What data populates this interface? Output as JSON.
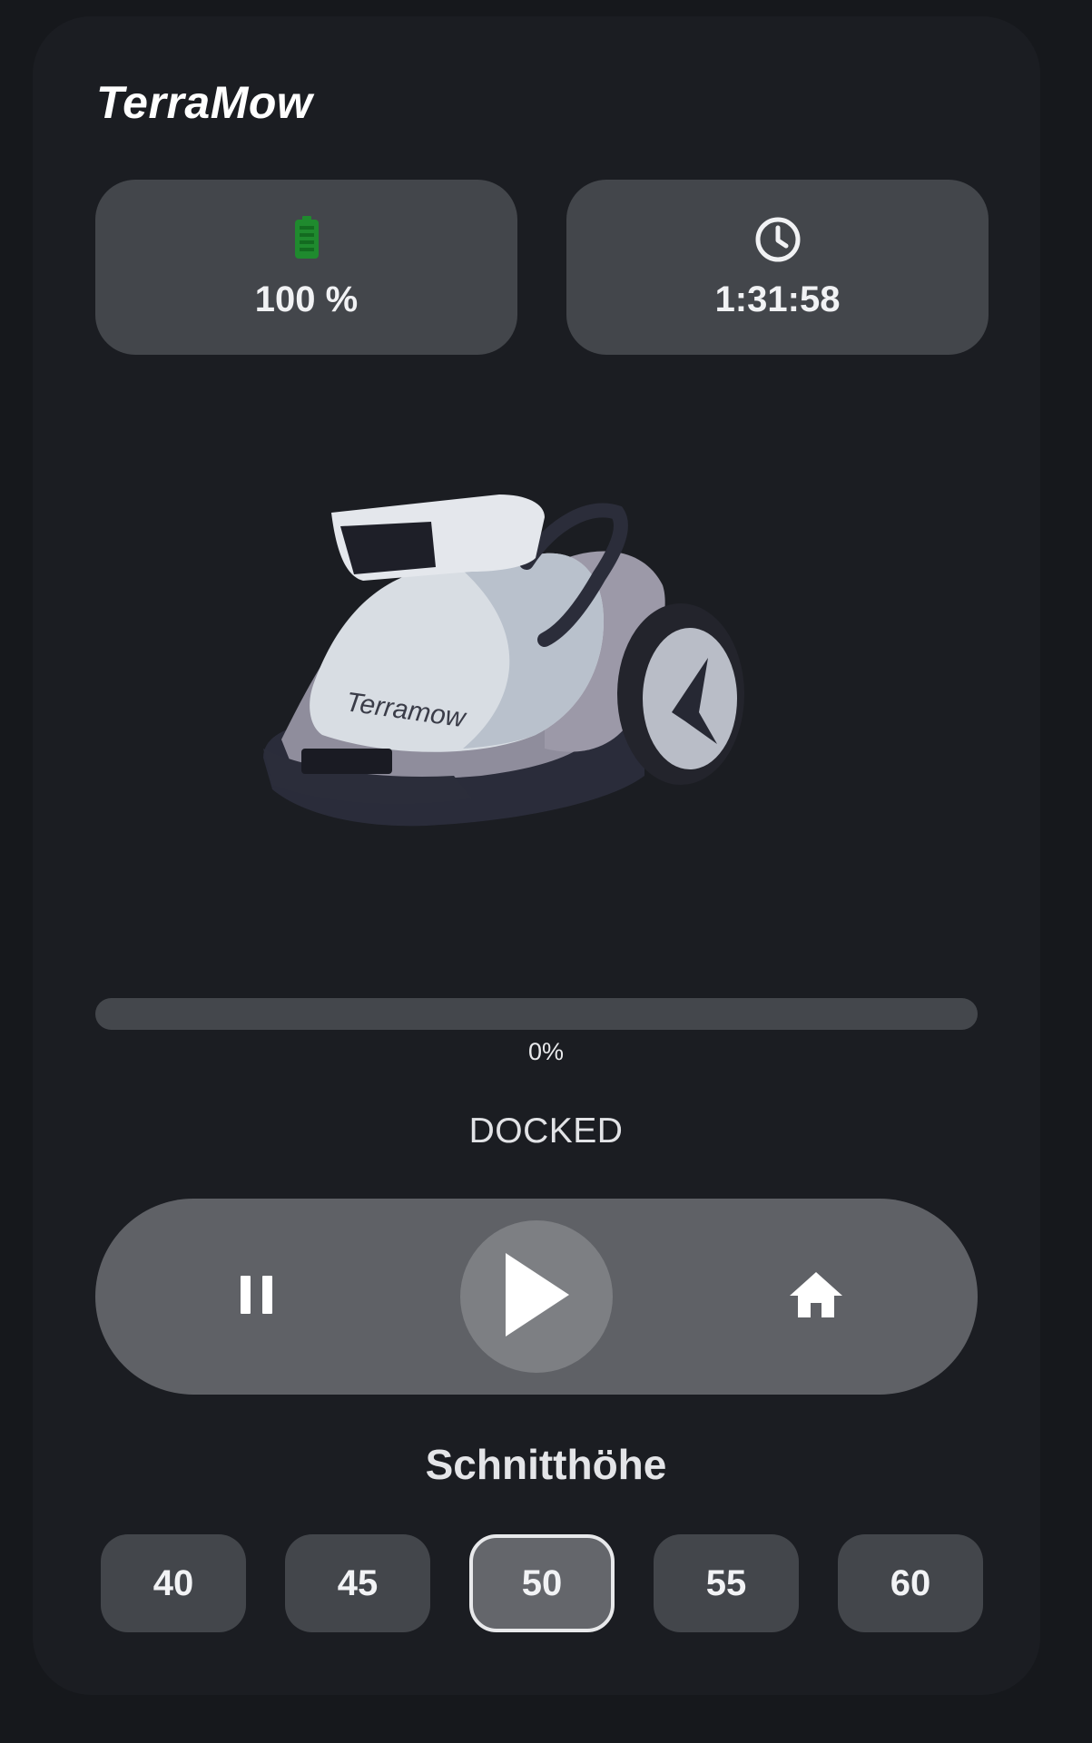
{
  "app": {
    "title": "TerraMow"
  },
  "stats": {
    "battery": {
      "value": "100 %",
      "icon": "battery-full-icon",
      "color": "#1f8a2e"
    },
    "runtime": {
      "value": "1:31:58",
      "icon": "clock-icon"
    }
  },
  "mower_image": {
    "brand_text": "Terramow"
  },
  "progress": {
    "percent": 0,
    "label": "0%"
  },
  "status": {
    "text": "DOCKED"
  },
  "controls": {
    "pause_icon": "pause-icon",
    "play_icon": "play-icon",
    "home_icon": "home-icon"
  },
  "cutting_height": {
    "title": "Schnitthöhe",
    "options": [
      "40",
      "45",
      "50",
      "55",
      "60"
    ],
    "selected": "50"
  },
  "colors": {
    "background": "#16181c",
    "card": "#1b1d22",
    "tile": "#43464b",
    "control_bar": "#5f6166",
    "accent_battery": "#1f8a2e"
  }
}
